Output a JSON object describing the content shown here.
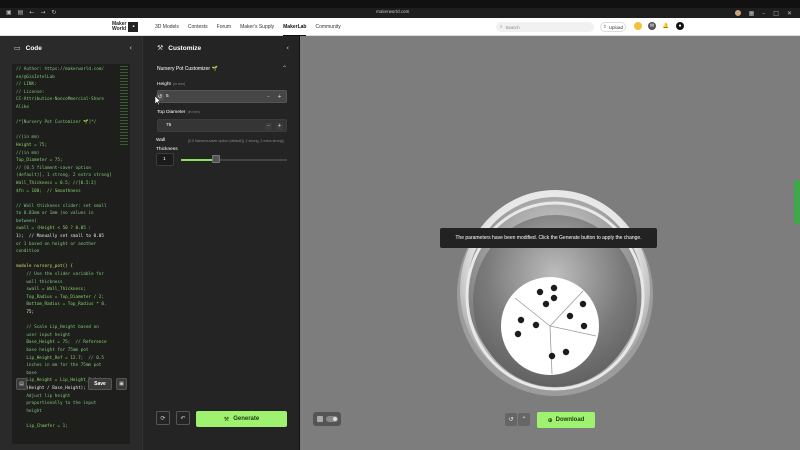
{
  "browser": {
    "url": "makerworld.com"
  },
  "header": {
    "logo_line1": "Maker",
    "logo_line2": "World",
    "nav": [
      "3D Models",
      "Contests",
      "Forum",
      "Maker's Supply",
      "MakerLab",
      "Community"
    ],
    "active_nav": "MakerLab",
    "search_placeholder": "Search",
    "upload_label": "Upload"
  },
  "code_panel": {
    "title": "Code",
    "save_label": "Save",
    "lines": [
      "// Author: https://makerworld.com/",
      "en/@GinIntelLab",
      "// LINK:",
      "// License:",
      "CC-Attribution-NoncoMmercial-Share",
      "Alike",
      "",
      "/*[Nursery Pot Customizer 🌱]*/",
      "",
      "//(in mm)",
      "Height = 75;",
      "//(in mm)",
      "Top_Diameter = 75;",
      "// [0.5 filament-saver option",
      "(default)], 1 strong, 2 extra strong]",
      "Wall_Thickness = 0.5; //[0.5:2]",
      "$fn = 100;  // Smoothness",
      "",
      "// Wall thickness slider: set small",
      "to 0.03mm or 1mm (no values in",
      "between)",
      "swall = (Height < 50 ? 0.05 :",
      "1);  // Manually set small to 0.05",
      "or 1 based on height or another",
      "condition",
      "",
      "module nursery_pot() {",
      "    // Use the slider variable for",
      "    wall thickness",
      "    swall = Wall_Thickness;",
      "    Top_Radius = Top_Diameter / 2;",
      "    Bottom_Radius = Top_Radius * 0.",
      "    75;",
      "",
      "    // Scale Lip_Height based on",
      "    user input height",
      "    Base_Height = 75;  // Reference",
      "    base height for 75mm pot",
      "    Lip_Height_Ref = 12.7;  // 0.5",
      "    inches in mm for the 75mm pot",
      "    base",
      "    Lip_Height = Lip_Height_Ref *",
      "    (Height / Base_Height);  //",
      "    Adjust lip height",
      "    proportionally to the input",
      "    height",
      "",
      "    Lip_Chamfer = 1;"
    ]
  },
  "customize_panel": {
    "title": "Customize",
    "section_title": "Nursery Pot Customizer 🌱",
    "height_label": "Height",
    "height_unit": "(in mm)",
    "height_value": "5",
    "top_diameter_label": "Top Diameter",
    "top_diameter_unit": "(in mm)",
    "top_diameter_value": "75",
    "wall_label_line1": "Wall",
    "wall_label_line2": "Thickness",
    "wall_desc": "[0.5 filament-saver option (default)], 1 strong, 2 extra strong]",
    "wall_value": "1",
    "wall_slider_fraction": 0.33,
    "generate_label": "Generate"
  },
  "viewport": {
    "toast": "The parameters have been modified. Click the Generate button to apply the change.",
    "download_label": "Download"
  },
  "colors": {
    "accent": "#9ff26f",
    "panel": "#242424",
    "viewport_bg": "#7d7d7d"
  }
}
